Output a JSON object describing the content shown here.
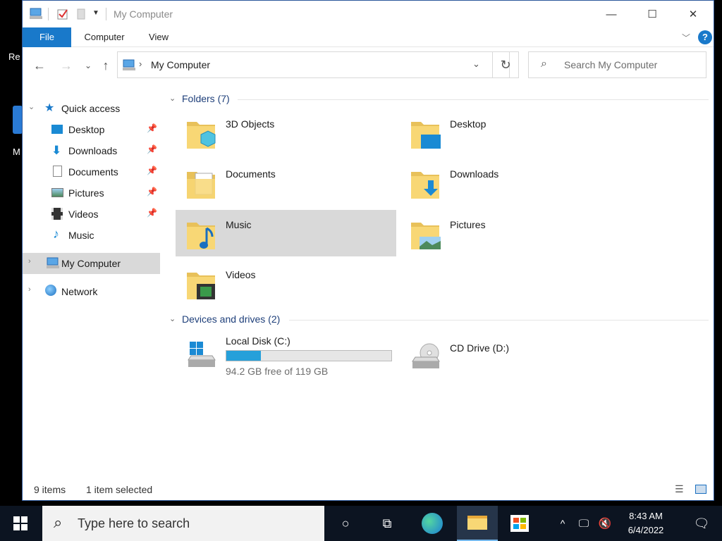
{
  "window": {
    "title": "My Computer",
    "minimize": "—",
    "maximize": "☐",
    "close": "✕"
  },
  "desktop": {
    "icon_label_1": "Re",
    "icon_label_2": "M"
  },
  "ribbon": {
    "tabs": [
      "File",
      "Computer",
      "View"
    ]
  },
  "address": {
    "path": "My Computer",
    "search_placeholder": "Search My Computer"
  },
  "nav": {
    "quick_access": "Quick access",
    "items": [
      "Desktop",
      "Downloads",
      "Documents",
      "Pictures",
      "Videos",
      "Music"
    ],
    "my_computer": "My Computer",
    "network": "Network"
  },
  "content": {
    "folders_header": "Folders (7)",
    "folders": [
      "3D Objects",
      "Desktop",
      "Documents",
      "Downloads",
      "Music",
      "Pictures",
      "Videos"
    ],
    "drives_header": "Devices and drives (2)",
    "drive_c": {
      "name": "Local Disk (C:)",
      "free": "94.2 GB free of 119 GB",
      "used_fraction": 0.21
    },
    "drive_d": {
      "name": "CD Drive (D:)"
    }
  },
  "status": {
    "items": "9 items",
    "selected": "1 item selected"
  },
  "taskbar": {
    "search_placeholder": "Type here to search",
    "time": "8:43 AM",
    "date": "6/4/2022"
  }
}
